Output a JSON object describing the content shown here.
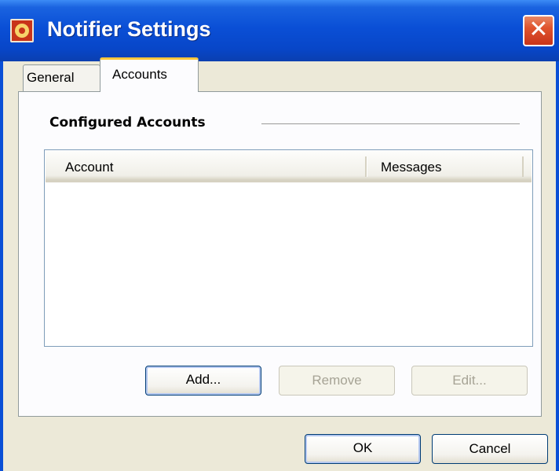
{
  "window": {
    "title": "Notifier Settings",
    "close_glyph": "✕",
    "icon": "notifier-app-icon"
  },
  "tabs": [
    {
      "label": "General",
      "selected": false
    },
    {
      "label": "Accounts",
      "selected": true
    }
  ],
  "accounts_section": {
    "title": "Configured Accounts",
    "list": {
      "columns": [
        {
          "label": "Account"
        },
        {
          "label": "Messages"
        }
      ],
      "rows": []
    },
    "buttons": {
      "add": "Add...",
      "remove": "Remove",
      "edit": "Edit..."
    }
  },
  "dialog_buttons": {
    "ok": "OK",
    "cancel": "Cancel"
  },
  "colors": {
    "titlebar": "#0a4fd6",
    "close_button": "#e0542e",
    "selected_tab_accent": "#ffc73c",
    "dialog_background": "#ece9d8"
  }
}
